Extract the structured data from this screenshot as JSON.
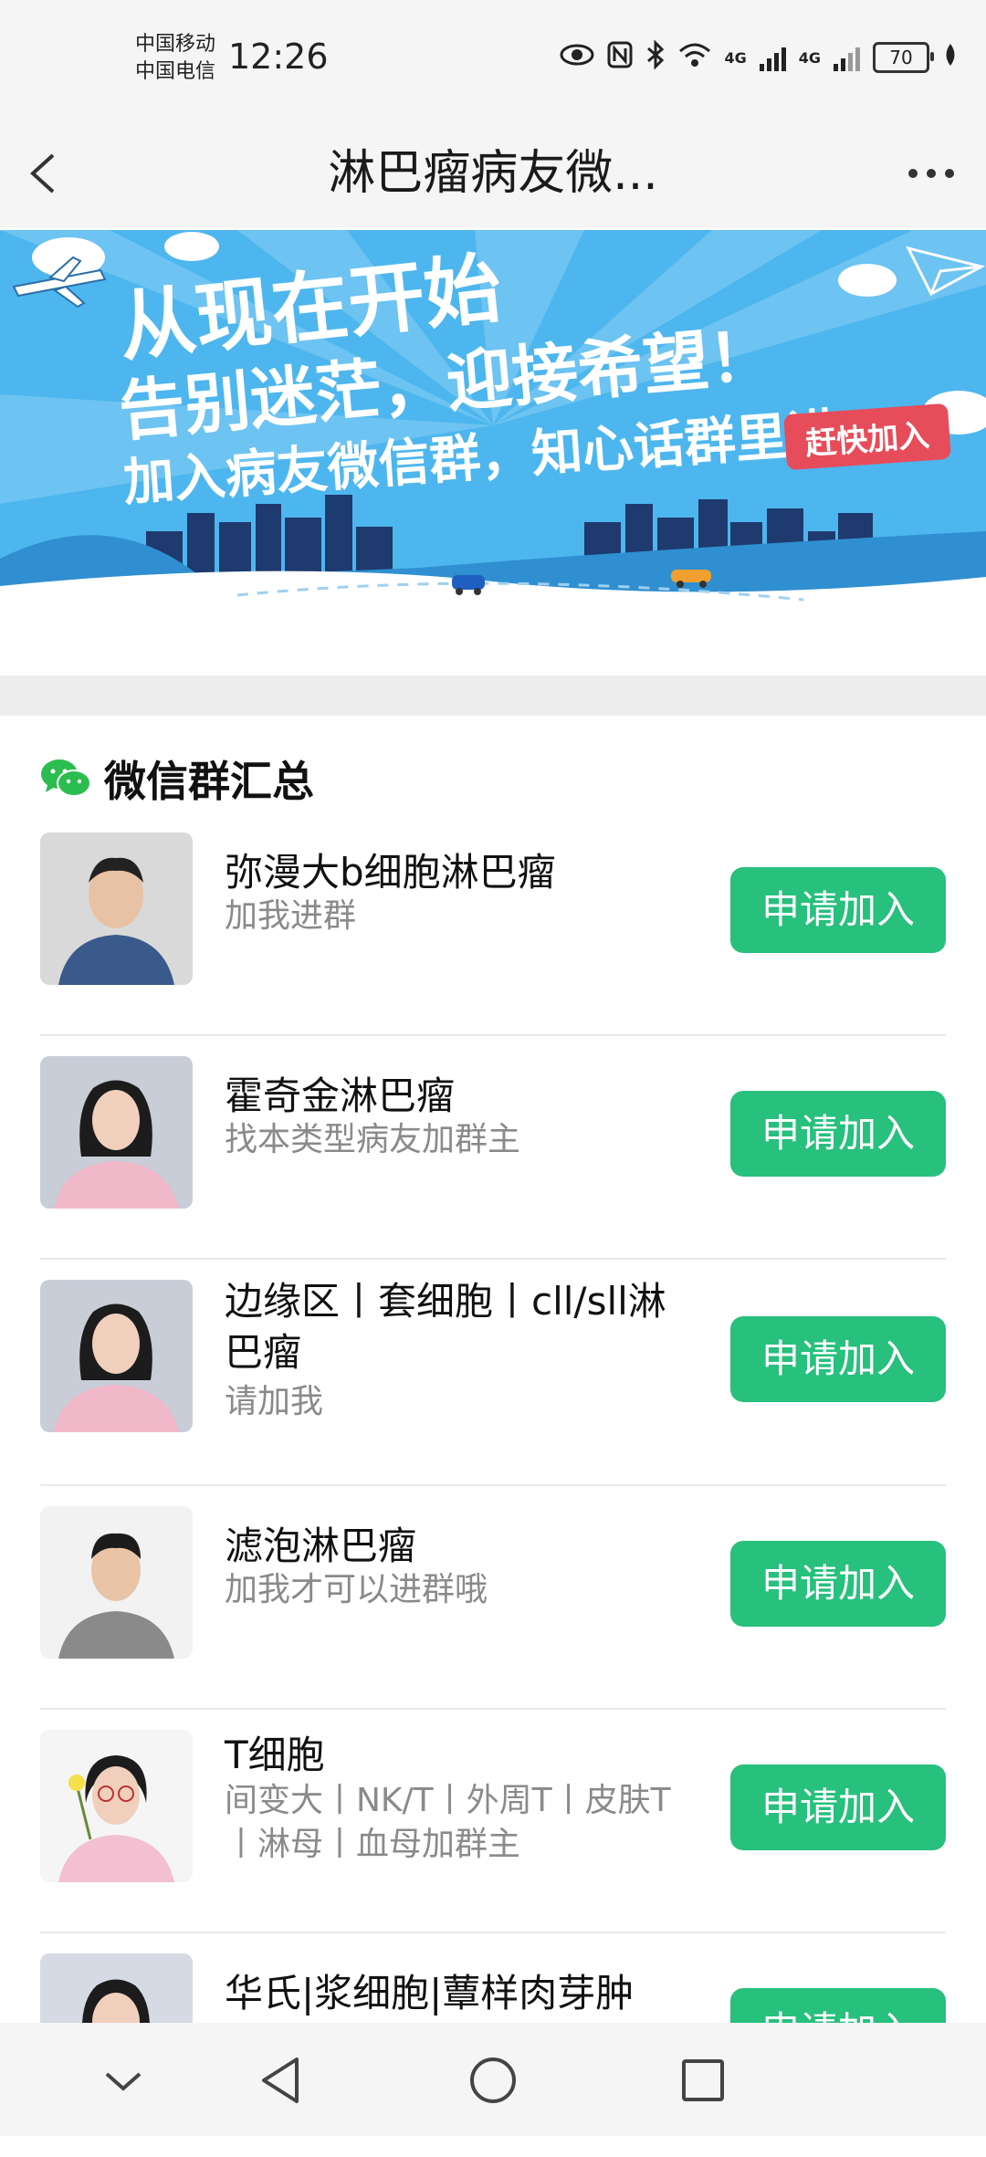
{
  "status_bar": {
    "carrier_1": "中国移动",
    "carrier_2": "中国电信",
    "time": "12:26",
    "network_1": "4G",
    "network_2": "4G",
    "battery": "70"
  },
  "header": {
    "title": "淋巴瘤病友微..."
  },
  "banner": {
    "line_1": "从现在开始",
    "line_2": "告别迷茫，迎接希望！",
    "line_3": "加入病友微信群，知心话群里讲",
    "tag": "赶快加入"
  },
  "section": {
    "title": "微信群汇总"
  },
  "groups": [
    {
      "name": "弥漫大b细胞淋巴瘤",
      "desc": "加我进群",
      "button": "申请加入"
    },
    {
      "name": "霍奇金淋巴瘤",
      "desc": "找本类型病友加群主",
      "button": "申请加入"
    },
    {
      "name": "边缘区丨套细胞丨cll/sll淋巴瘤",
      "desc": "请加我",
      "button": "申请加入"
    },
    {
      "name": "滤泡淋巴瘤",
      "desc": "加我才可以进群哦",
      "button": "申请加入"
    },
    {
      "name": "T细胞",
      "desc": "间变大丨NK/T丨外周T丨皮肤T丨淋母丨血母加群主",
      "button": "申请加入"
    },
    {
      "name": "华氏|浆细胞|蕈样肉芽肿",
      "desc": "",
      "button": "申请加入"
    }
  ],
  "colors": {
    "accent": "#27c07d",
    "banner_bg": "#4db6ee"
  }
}
